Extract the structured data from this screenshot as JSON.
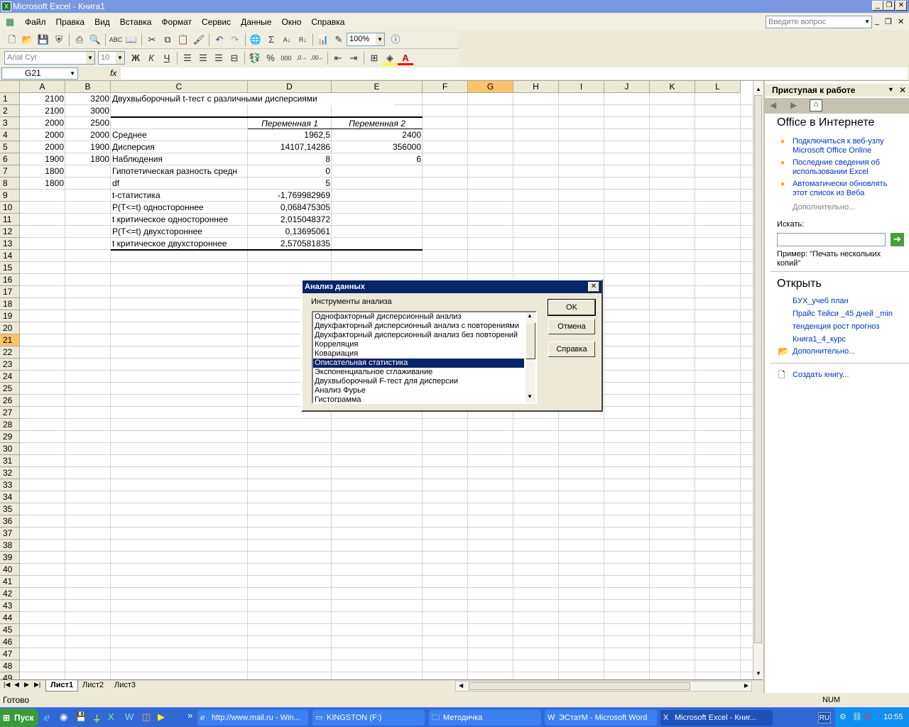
{
  "window": {
    "title": "Microsoft Excel - Книга1"
  },
  "menu": [
    "Файл",
    "Правка",
    "Вид",
    "Вставка",
    "Формат",
    "Сервис",
    "Данные",
    "Окно",
    "Справка"
  ],
  "help_box": {
    "placeholder": "Введите вопрос"
  },
  "toolbar": {
    "zoom": "100%",
    "font_name": "Arial Cyr",
    "font_size": "10"
  },
  "formula_bar": {
    "name_box": "G21",
    "fx": "fx",
    "content": ""
  },
  "columns": [
    "A",
    "B",
    "C",
    "D",
    "E",
    "F",
    "G",
    "H",
    "I",
    "J",
    "K",
    "L"
  ],
  "rows": [
    "1",
    "2",
    "3",
    "4",
    "5",
    "6",
    "7",
    "8",
    "9",
    "10",
    "11",
    "12",
    "13",
    "14",
    "15",
    "16",
    "17",
    "18",
    "19",
    "20",
    "21",
    "22",
    "23",
    "24",
    "25",
    "26",
    "27",
    "28",
    "29",
    "30",
    "31",
    "32",
    "33",
    "34",
    "35",
    "36",
    "37",
    "38",
    "39",
    "40",
    "41",
    "42",
    "43",
    "44",
    "45",
    "46",
    "47",
    "48",
    "49"
  ],
  "cells": {
    "A": [
      "2100",
      "2100",
      "2000",
      "2000",
      "2000",
      "1900",
      "1800",
      "1800"
    ],
    "B": [
      "3200",
      "3000",
      "2500",
      "2000",
      "1900",
      "1800"
    ],
    "c1": "Двухвыборочный t-тест с различными дисперсиями",
    "d3": "Переменная 1",
    "e3": "Переменная 2",
    "stats": [
      {
        "label": "Среднее",
        "d": "1962,5",
        "e": "2400"
      },
      {
        "label": "Дисперсия",
        "d": "14107,14286",
        "e": "356000"
      },
      {
        "label": "Наблюдения",
        "d": "8",
        "e": "6"
      },
      {
        "label": "Гипотетическая разность средн",
        "d": "0",
        "e": ""
      },
      {
        "label": "df",
        "d": "5",
        "e": ""
      },
      {
        "label": "t-статистика",
        "d": "-1,769982969",
        "e": ""
      },
      {
        "label": "P(T<=t) одностороннее",
        "d": "0,068475305",
        "e": ""
      },
      {
        "label": "t критическое одностороннее",
        "d": "2,015048372",
        "e": ""
      },
      {
        "label": "P(T<=t) двухстороннее",
        "d": "0,13695061",
        "e": ""
      },
      {
        "label": "t критическое двухстороннее",
        "d": "2,570581835",
        "e": ""
      }
    ]
  },
  "sheets": [
    "Лист1",
    "Лист2",
    "Лист3"
  ],
  "status": {
    "left": "Готово",
    "num": "NUM"
  },
  "task_pane": {
    "title": "Приступая к работе",
    "office_online": "Office в Интернете",
    "online_links": [
      "Подключиться к веб-узлу Microsoft Office Online",
      "Последние сведения об использовании Excel",
      "Автоматически обновлять этот список из Веба"
    ],
    "more": "Дополнительно...",
    "search_label": "Искать:",
    "example": "Пример: \"Печать нескольких копий\"",
    "open_title": "Открыть",
    "files": [
      "БУХ_учеб план",
      "Прайс Тейси _45 дней _min",
      "тенденция рост прогноз",
      "Книга1_4_курс"
    ],
    "more_files": "Дополнительно...",
    "create": "Создать книгу..."
  },
  "dialog": {
    "title": "Анализ данных",
    "label": "Инструменты анализа",
    "items": [
      "Однофакторный дисперсионный анализ",
      "Двухфакторный дисперсионный анализ с повторениями",
      "Двухфакторный дисперсионный анализ без повторений",
      "Корреляция",
      "Ковариация",
      "Описательная статистика",
      "Экспоненциальное сглаживание",
      "Двухвыборочный F-тест для дисперсии",
      "Анализ Фурье",
      "Гистограмма"
    ],
    "selected_index": 5,
    "ok": "OK",
    "cancel": "Отмена",
    "help": "Справка"
  },
  "taskbar": {
    "start": "Пуск",
    "tasks": [
      "http://www.mail.ru - Win...",
      "KINGSTON (F:)",
      "Методичка",
      "ЭСтатМ - Microsoft Word",
      "Microsoft Excel - Книг..."
    ],
    "lang": "RU",
    "clock": "10:55"
  }
}
